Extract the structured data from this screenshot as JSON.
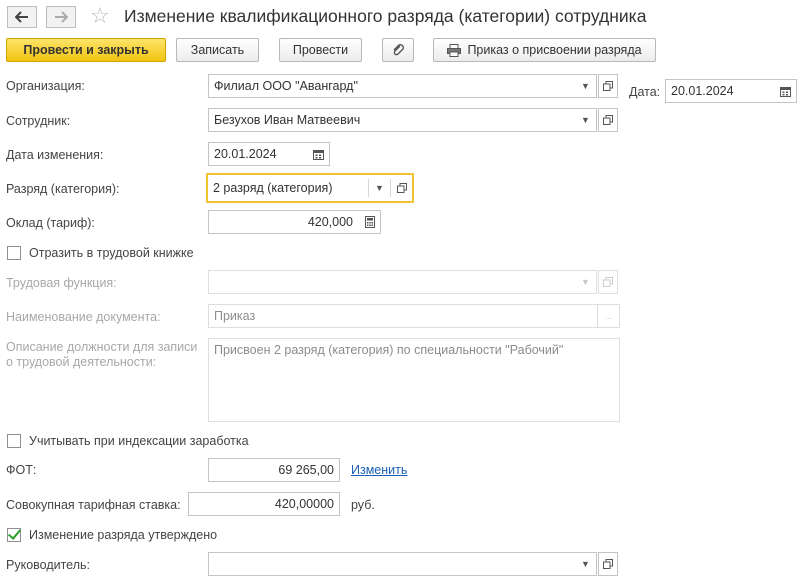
{
  "header": {
    "back_icon": "arrow-left-icon",
    "forward_icon": "arrow-right-icon",
    "favorite_icon": "star-icon",
    "title": "Изменение квалификационного разряда (категории) сотрудника"
  },
  "toolbar": {
    "post_and_close": "Провести и закрыть",
    "save": "Записать",
    "post": "Провести",
    "attach_icon": "paperclip-icon",
    "print_order": "Приказ о присвоении разряда",
    "print_icon": "printer-icon"
  },
  "form": {
    "organization": {
      "label": "Организация:",
      "value": "Филиал ООО \"Авангард\""
    },
    "date": {
      "label": "Дата:",
      "value": "20.01.2024"
    },
    "employee": {
      "label": "Сотрудник:",
      "value": "Безухов Иван Матвеевич"
    },
    "change_date": {
      "label": "Дата изменения:",
      "value": "20.01.2024"
    },
    "grade": {
      "label": "Разряд (категория):",
      "value": "2 разряд (категория)"
    },
    "salary": {
      "label": "Оклад (тариф):",
      "value": "420,000"
    },
    "reflect_in_workbook": {
      "label": "Отразить в трудовой книжке",
      "checked": false
    },
    "labor_function": {
      "label": "Трудовая функция:",
      "value": ""
    },
    "document_name": {
      "label": "Наименование документа:",
      "value": "Приказ"
    },
    "position_description": {
      "label_line1": "Описание должности для записи",
      "label_line2": "о трудовой деятельности:",
      "value": "Присвоен 2 разряд (категория) по специальности \"Рабочий\""
    },
    "consider_indexation": {
      "label": "Учитывать при индексации заработка",
      "checked": false
    },
    "fot": {
      "label": "ФОТ:",
      "value": "69 265,00",
      "change_link": "Изменить"
    },
    "total_rate": {
      "label": "Совокупная тарифная ставка:",
      "value": "420,00000",
      "unit": "руб."
    },
    "approved": {
      "label": "Изменение разряда утверждено",
      "checked": true
    },
    "manager": {
      "label": "Руководитель:",
      "value": ""
    }
  },
  "colors": {
    "primary_button": "#f1c40f",
    "focus_border": "#f1c232",
    "link": "#1a5fb4",
    "check": "#2b9e2b"
  }
}
